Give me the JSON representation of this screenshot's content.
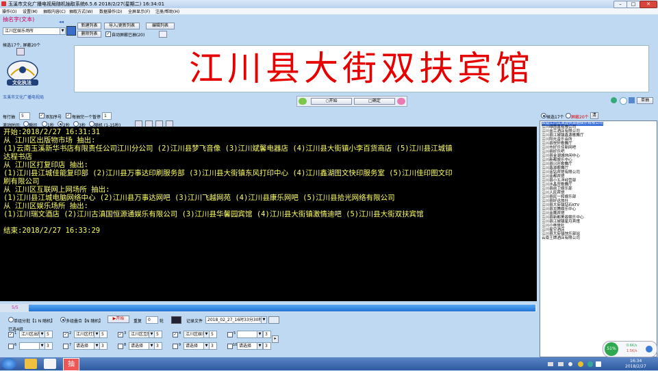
{
  "window": {
    "title": "玉溪市文化广播电视局随机抽取系统6.5.6  2018/2/27(星期二) 16:34:01",
    "min": "–",
    "max": "□",
    "close": "✕"
  },
  "menu": [
    "操作(O)",
    "设置(M)",
    "抽取内容(C)",
    "抽取方式(W)",
    "数据操作(D)",
    "全屏显示(F)",
    "注册/帮助(H)"
  ],
  "left_top": {
    "sel_label": "抽名字(文本)",
    "combo_value": "江川区娱乐场所",
    "btn_new_list": "新建列表",
    "btn_import": "导入/更新列表",
    "btn_edit_list": "编辑列表",
    "btn_delete_list": "删除列表",
    "chk_auto_hide": "自动屏蔽已抽(20)",
    "count_text": "候选17个, 屏蔽20个",
    "logo_text": "文化执法",
    "org_name": "玉溪市文化广播电视局"
  },
  "banner_text": "江川县大街双扶宾馆",
  "controls": {
    "start": "○开始",
    "stop": "□确定",
    "each_label": "每行抽",
    "each_value": "5",
    "chk_serial": "添加序号",
    "chk_repeat": "每抽完一个暂停",
    "repeat_num": "1",
    "speed_label": "滚动时间:",
    "speed_opts": [
      "瞬间",
      "1秒",
      "2秒",
      "3秒",
      "随机 (1-15秒)"
    ]
  },
  "results": [
    "开始:2018/2/27 16:31:31",
    "从 江川区出版物市场 抽出:",
    "  (1)云南玉溪新华书店有限责任公司江川分公司  (2)江川县梦飞音像  (3)江川斌馨电器店  (4)江川县大街镇小李百货商店  (5)江川县江城镇",
    "达程书店",
    "从 江川区打复印店 抽出:",
    "  (1)江川县江城佳能复印部  (2)江川县万事达印刷服务部  (3)江川县大街镇东风打印中心  (4)江川鑫湖图文快印服务室  (5)江川佳印图文印",
    "刷有限公司",
    "从 江川区互联网上网场所 抽出:",
    "  (1)江川县江城电脑网络中心  (2)江川县万事达网吧  (3)江川飞越网苑  (4)江川县康乐网吧  (5)江川县拾光网络有限公司",
    "从 江川区娱乐场所 抽出:",
    "  (1)江川瑞文酒店  (2)江川古滇国恒源通娱乐有限公司  (3)江川县华馨园宾馆  (4)江川县大街镇激情迪吧  (5)江川县大街双扶宾馆",
    "",
    "结束:2018/2/27 16:33:29"
  ],
  "right": {
    "radio_candidates": "候选17个",
    "radio_hidden": "屏蔽20个",
    "btn_clear": "清",
    "btn_single": "单抽",
    "items": [
      "云南江川古滇国恒源通娱乐有限公司",
      "江川绿茵鑫有限公司",
      "江川金兰酒店有限公司",
      "江川县江城镇鑫源歌舞厅",
      "江川阳光音乐会所",
      "江川县悦轩歌舞厅",
      "江川市好乐佳新网吧",
      "江川县好乐吧",
      "江川县金湖城休闲中心",
      "江川新都娱乐中心",
      "江川县兴旺歌舞厅",
      "江川鑫源歌舞厅",
      "江川金钻宾馆有限公司",
      "江川金都宾馆",
      "江川县小五洋经营部",
      "江川水晶宫歌舞厅",
      "江川县前卫娱乐部",
      "江川人民宾馆",
      "江川县民一和娱乐部",
      "江川县好运旅社",
      "江川县大街镇钻石KTV",
      "江川县龙腾娱乐中心",
      "江川金鹰宾馆",
      "江川县新都美容娱乐中心",
      "江川县江城镇星月宾馆",
      "江川小林旅社",
      "江川星空酒店",
      "江川县大街镇快乐驿站",
      "云南王牌酒店有限公司"
    ]
  },
  "bottom": {
    "progress_text": "5/5",
    "radio_single": "单组分批【1 N 随机】",
    "radio_multi": "多组叠合【N 随机】",
    "start2": "开始",
    "repeat_label": "重复",
    "repeat_value": "0",
    "repeat_unit": "轮",
    "record_label": "记录文件",
    "record_value": "2018_02_27_16时33分30秒",
    "group_label": "已选4组",
    "groups": [
      {
        "n": "1",
        "name": "江川区出版",
        "cnt": "5"
      },
      {
        "n": "2",
        "name": "江川区打复",
        "cnt": "5"
      },
      {
        "n": "3",
        "name": "江川区互联",
        "cnt": "5"
      },
      {
        "n": "4",
        "name": "江川区娱乐",
        "cnt": "5"
      },
      {
        "n": "5",
        "name": "",
        "cnt": "3"
      },
      {
        "n": "6",
        "name": "",
        "cnt": "3"
      },
      {
        "n": "7",
        "name": "请选择",
        "cnt": "3"
      },
      {
        "n": "8",
        "name": "请选择",
        "cnt": "3"
      },
      {
        "n": "9",
        "name": "请选择",
        "cnt": "3"
      },
      {
        "n": "10",
        "name": "请选择",
        "cnt": "3"
      }
    ],
    "gauge_pct": "51%",
    "net_up": "0.6K/s",
    "net_down": "1.5K/s"
  },
  "taskbar": {
    "time": "16:34",
    "date": "2018/2/27",
    "app_label": "抽"
  }
}
